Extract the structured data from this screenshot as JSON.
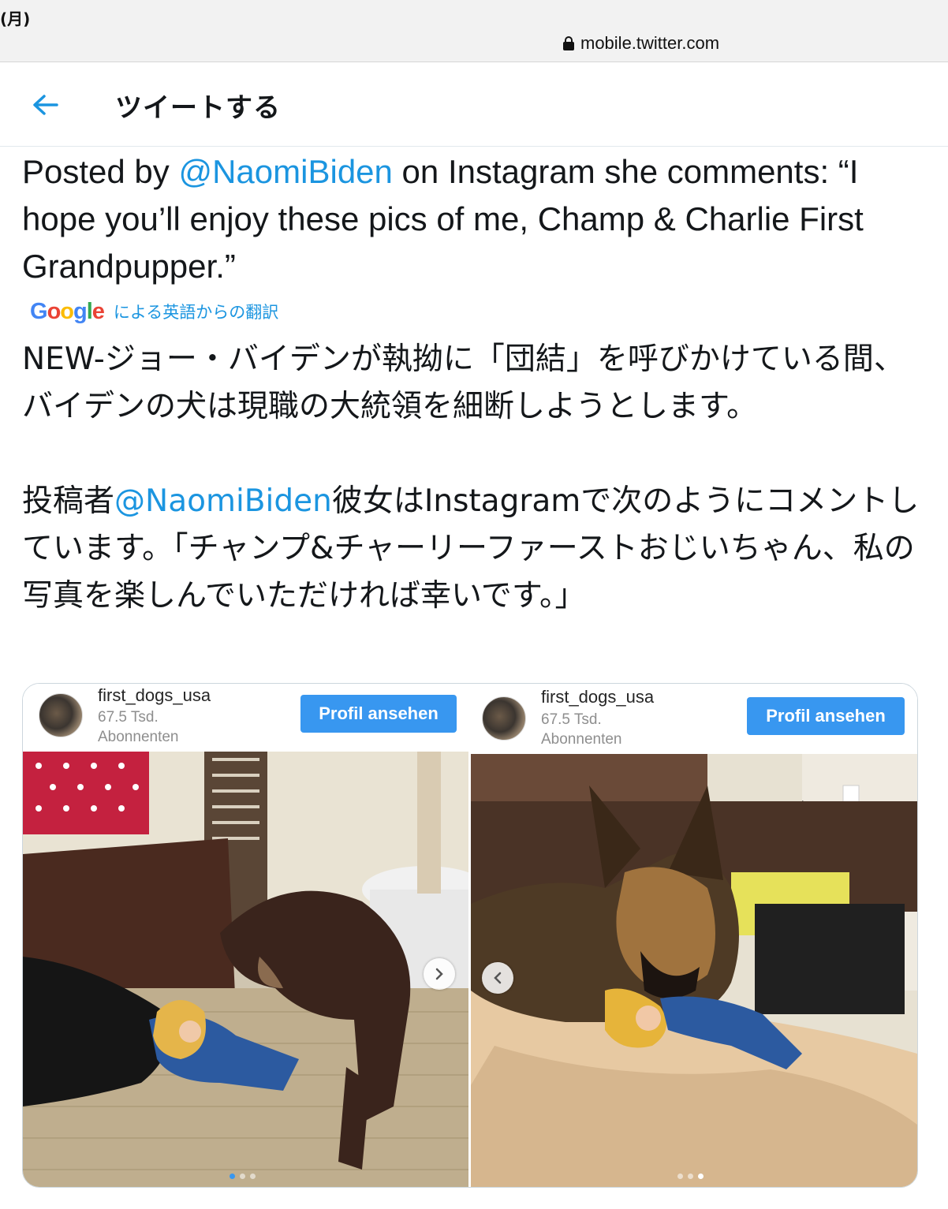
{
  "status_bar": {
    "day": "(月)",
    "url": "mobile.twitter.com"
  },
  "header": {
    "title": "ツイートする"
  },
  "tweet": {
    "en_prefix": "Posted by ",
    "en_mention": "@NaomiBiden",
    "en_suffix": " on Instagram she comments: “I hope you’ll enjoy these pics of me, Champ & Charlie First Grandpupper.”",
    "translation_label": "による英語からの翻訳",
    "translation_provider": "Google",
    "ja_para1": "NEW-ジョー・バイデンが執拗に「団結」を呼びかけている間、バイデンの犬は現職の大統領を細断しようとします。",
    "ja_para2_prefix": "投稿者",
    "ja_para2_mention": "@NaomiBiden",
    "ja_para2_suffix": "彼女はInstagramで次のようにコメントしています。「チャンプ&チャーリーファーストおじいちゃん、私の写真を楽しんでいただければ幸いです。」"
  },
  "media": {
    "panels": [
      {
        "account": "first_dogs_usa",
        "followers": "67.5 Tsd.",
        "followers_label": "Abonnenten",
        "button": "Profil ansehen",
        "arrow": "next"
      },
      {
        "account": "first_dogs_usa",
        "followers": "67.5 Tsd.",
        "followers_label": "Abonnenten",
        "button": "Profil ansehen",
        "arrow": "prev"
      }
    ]
  },
  "colors": {
    "link": "#1b95e0",
    "ig_button": "#3897f0"
  },
  "icons": {
    "back": "arrow-left-icon",
    "lock": "lock-icon",
    "next": "chevron-right-icon",
    "prev": "chevron-left-icon"
  }
}
